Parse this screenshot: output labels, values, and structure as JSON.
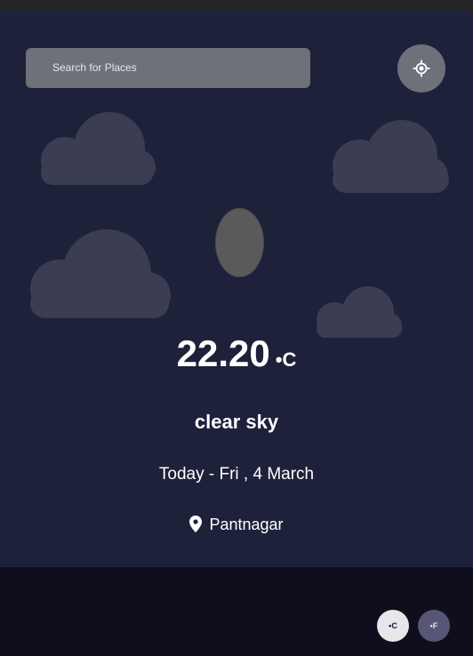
{
  "search": {
    "label": "Search for Places"
  },
  "icons": {
    "locate": "crosshair-gps-icon",
    "location": "map-pin-icon"
  },
  "weather": {
    "temperature": "22.20",
    "unit": "•C",
    "description": "clear sky",
    "date": "Today - Fri , 4 March",
    "location": "Pantnagar"
  },
  "units": {
    "celsius": "•C",
    "fahrenheit": "•F"
  },
  "colors": {
    "panel": "#1e213a",
    "background": "#100e1d",
    "search_bg": "#6e707a",
    "cloud": "#3b3d52"
  }
}
